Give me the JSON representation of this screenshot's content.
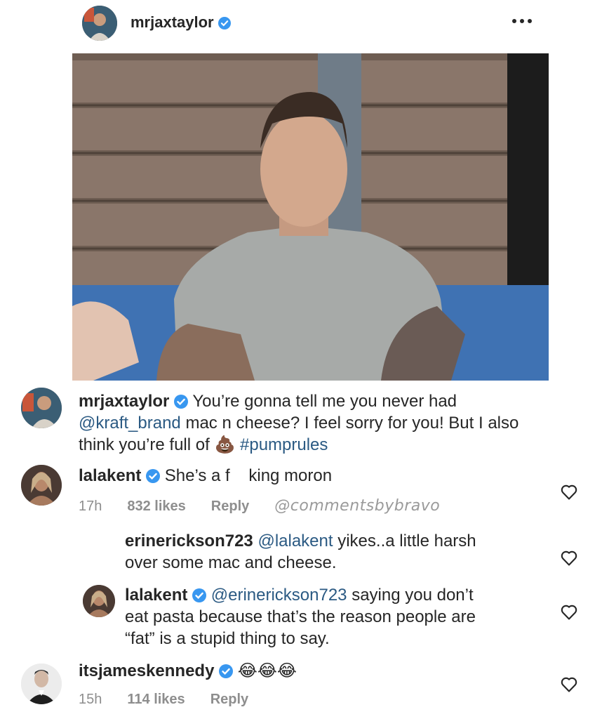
{
  "post": {
    "author": "mrjaxtaylor",
    "more_icon": "more-dots-icon"
  },
  "caption": {
    "username": "mrjaxtaylor",
    "text_1": "You’re gonna tell me you never had",
    "mention": "@kraft_brand",
    "text_2": " mac n cheese? I feel sorry for you! But I also",
    "text_3": "think you’re full of ",
    "emoji": "💩",
    "hashtag": " #pumprules"
  },
  "comments": [
    {
      "username": "lalakent",
      "text": "She’s a f    king moron",
      "time": "17h",
      "likes": "832 likes",
      "reply": "Reply",
      "watermark": "@commentsbybravo"
    },
    {
      "username": "erinerickson723",
      "mention": "@lalakent",
      "text_1": " yikes..a little harsh",
      "text_2": "over some mac and cheese."
    },
    {
      "username": "lalakent",
      "mention": "@erinerickson723",
      "text_1": " saying you don’t",
      "text_2": "eat pasta because that’s the reason people are",
      "text_3": "“fat” is a stupid thing to say."
    },
    {
      "username": "itsjameskennedy",
      "emoji": "😂😂😂",
      "time": "15h",
      "likes": "114 likes",
      "reply": "Reply"
    }
  ],
  "colors": {
    "verified": "#3897f0",
    "link": "#2b5a83",
    "muted": "#8e8e8e"
  }
}
